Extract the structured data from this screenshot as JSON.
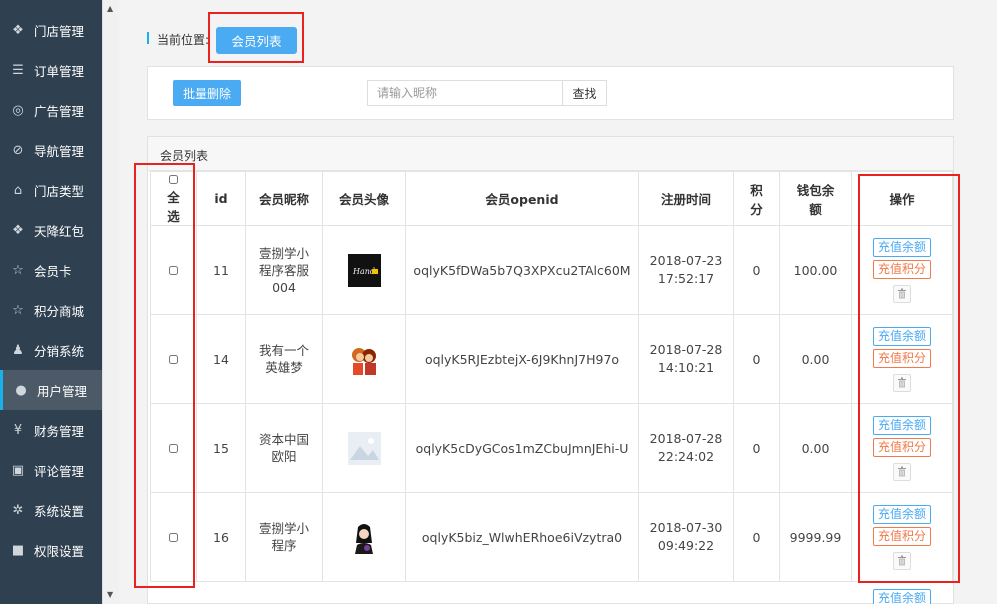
{
  "sidebar": {
    "items": [
      {
        "label": "门店管理",
        "icon": "cubes-icon",
        "glyph": "❖",
        "active": false
      },
      {
        "label": "订单管理",
        "icon": "list-icon",
        "glyph": "☰",
        "active": false
      },
      {
        "label": "广告管理",
        "icon": "lifebuoy-icon",
        "glyph": "◎",
        "active": false
      },
      {
        "label": "导航管理",
        "icon": "compass-icon",
        "glyph": "⊘",
        "active": false
      },
      {
        "label": "门店类型",
        "icon": "bank-icon",
        "glyph": "⌂",
        "active": false
      },
      {
        "label": "天降红包",
        "icon": "cubes-icon",
        "glyph": "❖",
        "active": false
      },
      {
        "label": "会员卡",
        "icon": "star-icon",
        "glyph": "☆",
        "active": false
      },
      {
        "label": "积分商城",
        "icon": "star-icon",
        "glyph": "☆",
        "active": false
      },
      {
        "label": "分销系统",
        "icon": "users-icon",
        "glyph": "♟",
        "active": false
      },
      {
        "label": "用户管理",
        "icon": "user-icon",
        "glyph": "●",
        "active": true
      },
      {
        "label": "财务管理",
        "icon": "yen-icon",
        "glyph": "¥",
        "active": false
      },
      {
        "label": "评论管理",
        "icon": "money-icon",
        "glyph": "▣",
        "active": false
      },
      {
        "label": "系统设置",
        "icon": "gear-icon",
        "glyph": "✲",
        "active": false
      },
      {
        "label": "权限设置",
        "icon": "lock-icon",
        "glyph": "■",
        "active": false
      }
    ]
  },
  "breadcrumb": {
    "label": "当前位置:",
    "current": "会员列表"
  },
  "toolbar": {
    "bulk_delete": "批量删除",
    "search_placeholder": "请输入昵称",
    "search_value": "",
    "search_button": "查找"
  },
  "panel": {
    "title": "会员列表"
  },
  "table": {
    "headers": {
      "select_all_line1": "全",
      "select_all_line2": "选",
      "id": "id",
      "nickname": "会员昵称",
      "avatar": "会员头像",
      "openid": "会员openid",
      "reg_time": "注册时间",
      "points_line1": "积",
      "points_line2": "分",
      "wallet_line1": "钱包余",
      "wallet_line2": "额",
      "actions": "操作"
    },
    "rows": [
      {
        "id": "11",
        "nick1": "壹捌学小",
        "nick2": "程序客服",
        "nick3": "004",
        "avatar": "hand-logo-avatar",
        "openid": "oqlyK5fDWa5b7Q3XPXcu2TAlc60M",
        "date": "2018-07-23",
        "time": "17:52:17",
        "points": "0",
        "wallet": "100.00"
      },
      {
        "id": "14",
        "nick1": "我有一个",
        "nick2": "英雄梦",
        "nick3": "",
        "avatar": "cartoon-couple-avatar",
        "openid": "oqlyK5RJEzbtejX-6J9KhnJ7H97o",
        "date": "2018-07-28",
        "time": "14:10:21",
        "points": "0",
        "wallet": "0.00"
      },
      {
        "id": "15",
        "nick1": "资本中国",
        "nick2": "欧阳",
        "nick3": "",
        "avatar": "placeholder-image-avatar",
        "openid": "oqlyK5cDyGCos1mZCbuJmnJEhi-U",
        "date": "2018-07-28",
        "time": "22:24:02",
        "points": "0",
        "wallet": "0.00"
      },
      {
        "id": "16",
        "nick1": "壹捌学小",
        "nick2": "程序",
        "nick3": "",
        "avatar": "girl-avatar",
        "openid": "oqlyK5biz_WlwhERhoe6iVzytra0",
        "date": "2018-07-30",
        "time": "09:49:22",
        "points": "0",
        "wallet": "9999.99"
      }
    ],
    "actions": {
      "recharge_balance": "充值余额",
      "recharge_points": "充值积分",
      "delete_icon": "trash-icon"
    }
  },
  "avatar_text": {
    "hand": "Hand"
  },
  "colors": {
    "sidebar_bg": "#2f4050",
    "accent_blue": "#4aaaf2",
    "accent_orange": "#f07a4a",
    "highlight_red": "#e8231f"
  }
}
